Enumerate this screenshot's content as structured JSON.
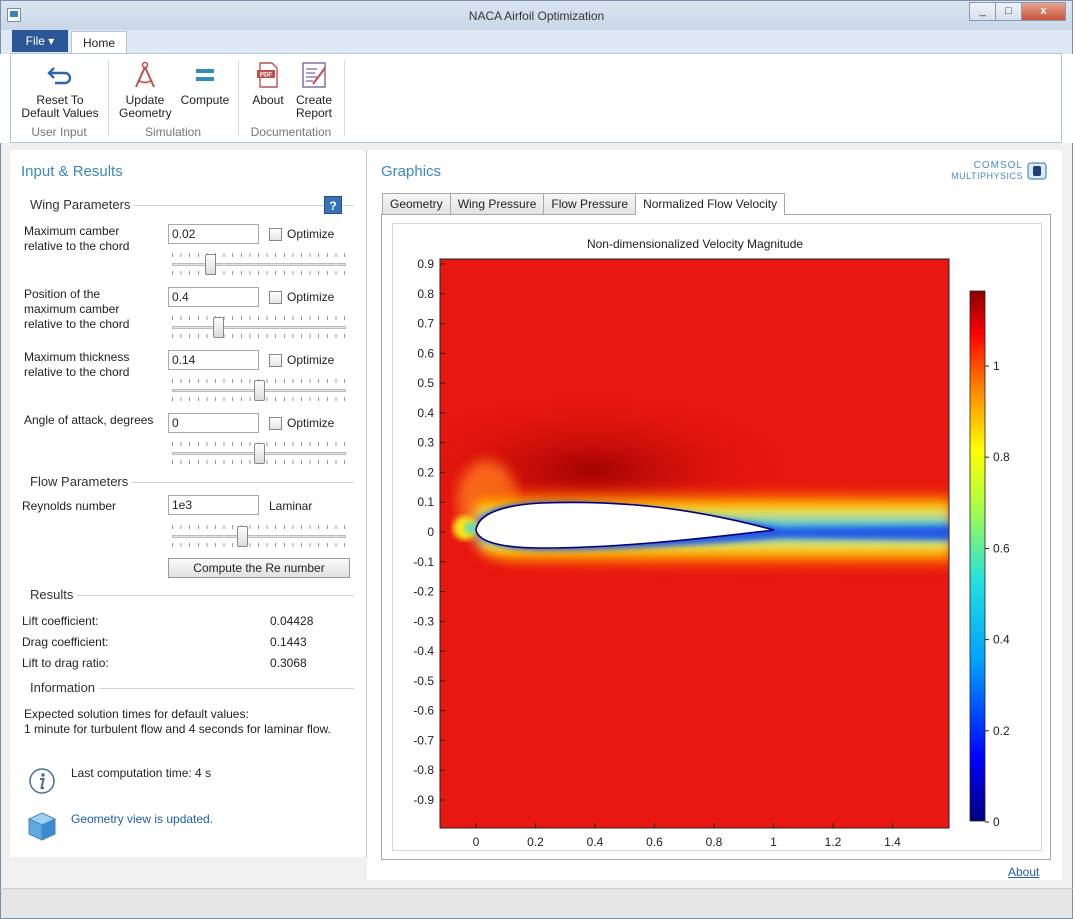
{
  "window": {
    "title": "NACA Airfoil Optimization",
    "minimize": "_",
    "maximize": "□",
    "close": "x"
  },
  "ribbon": {
    "file_tab": "File ▾",
    "home_tab": "Home",
    "groups": {
      "user_input": "User Input",
      "simulation": "Simulation",
      "documentation": "Documentation"
    },
    "buttons": {
      "reset_line1": "Reset To",
      "reset_line2": "Default Values",
      "update_line1": "Update",
      "update_line2": "Geometry",
      "compute": "Compute",
      "about": "About",
      "report_line1": "Create",
      "report_line2": "Report"
    }
  },
  "left": {
    "title": "Input & Results",
    "wing": {
      "heading": "Wing Parameters",
      "help": "?",
      "params": [
        {
          "label_l1": "Maximum camber",
          "label_l2": "relative to the chord",
          "label_l3": "",
          "value": "0.02",
          "optimize": "Optimize",
          "slider_fraction": 0.2
        },
        {
          "label_l1": "Position of the",
          "label_l2": "maximum camber",
          "label_l3": "relative to the chord",
          "value": "0.4",
          "optimize": "Optimize",
          "slider_fraction": 0.25
        },
        {
          "label_l1": "Maximum thickness",
          "label_l2": "relative to the chord",
          "label_l3": "",
          "value": "0.14",
          "optimize": "Optimize",
          "slider_fraction": 0.5
        },
        {
          "label_l1": "Angle of attack, degrees",
          "label_l2": "",
          "label_l3": "",
          "value": "0",
          "optimize": "Optimize",
          "slider_fraction": 0.5
        }
      ]
    },
    "flow": {
      "heading": "Flow Parameters",
      "re_label": "Reynolds number",
      "re_value": "1e3",
      "regime": "Laminar",
      "slider_fraction": 0.4,
      "compute_btn": "Compute the Re number"
    },
    "results": {
      "heading": "Results",
      "rows": [
        {
          "label": "Lift coefficient:",
          "value": "0.04428"
        },
        {
          "label": "Drag coefficient:",
          "value": "0.1443"
        },
        {
          "label": "Lift to drag ratio:",
          "value": "0.3068"
        }
      ]
    },
    "information": {
      "heading": "Information",
      "line1": "Expected solution times for default values:",
      "line2": "1 minute for turbulent flow and 4 seconds for laminar flow.",
      "last_computation": "Last computation time: 4 s",
      "geometry_status": "Geometry view is updated."
    }
  },
  "graphics": {
    "title": "Graphics",
    "logo_l1": "COMSOL",
    "logo_l2": "MULTIPHYSICS",
    "tabs": [
      "Geometry",
      "Wing Pressure",
      "Flow Pressure",
      "Normalized Flow Velocity"
    ],
    "active_tab": 3,
    "plot_title": "Non-dimensionalized Velocity Magnitude",
    "x_ticks": [
      "0",
      "0.2",
      "0.4",
      "0.6",
      "0.8",
      "1",
      "1.2",
      "1.4"
    ],
    "y_ticks": [
      "0.9",
      "0.8",
      "0.7",
      "0.6",
      "0.5",
      "0.4",
      "0.3",
      "0.2",
      "0.1",
      "0",
      "-0.1",
      "-0.2",
      "-0.3",
      "-0.4",
      "-0.5",
      "-0.6",
      "-0.7",
      "-0.8",
      "-0.9"
    ],
    "colorbar_ticks": [
      "1",
      "0.8",
      "0.6",
      "0.4",
      "0.2",
      "0"
    ],
    "colors": {
      "field": "#e8170f",
      "dark": "#8b0000"
    }
  },
  "footer": {
    "about": "About"
  }
}
